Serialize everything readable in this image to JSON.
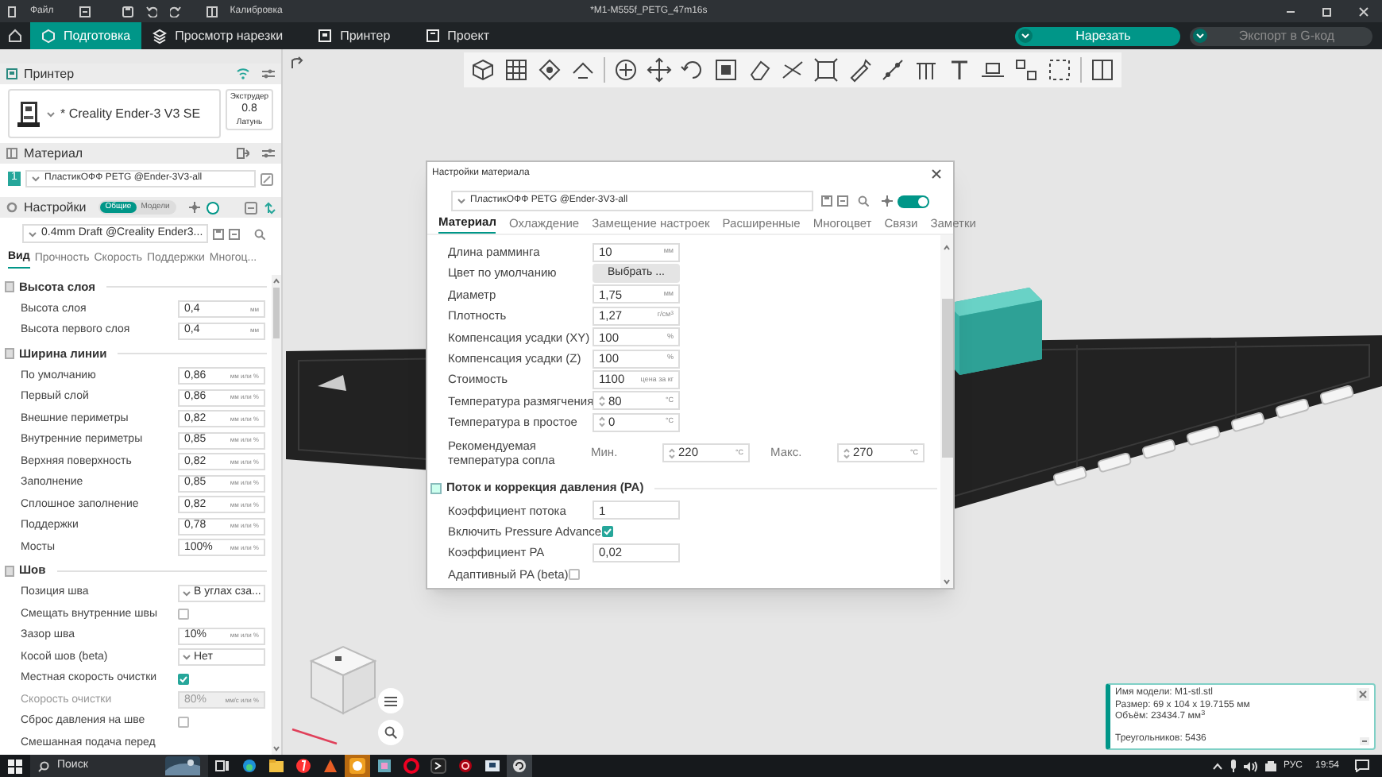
{
  "title_bar": {
    "menu": "Файл",
    "calibration": "Калибровка",
    "title": "*M1-M555f_PETG_47m16s"
  },
  "main_tabs": [
    {
      "label": "Подготовка",
      "selected": true
    },
    {
      "label": "Просмотр нарезки",
      "selected": false
    },
    {
      "label": "Принтер",
      "selected": false
    },
    {
      "label": "Проект",
      "selected": false
    }
  ],
  "slice_button": {
    "label": "Нарезать",
    "disabled": false
  },
  "export_button": {
    "label": "Экспорт в G-код",
    "disabled": true
  },
  "printer": {
    "heading": "Принтер",
    "name": "* Creality Ender-3 V3 SE",
    "extruder_label": "Экструдер",
    "nozzle": "0.8",
    "nozzle_material": "Латунь"
  },
  "material": {
    "heading": "Материал",
    "slot": "1",
    "filament": "ПластикОФФ PETG @Ender-3V3-all"
  },
  "settings": {
    "heading": "Настройки",
    "scope": [
      {
        "label": "Общие",
        "selected": true
      },
      {
        "label": "Модели",
        "selected": false
      }
    ],
    "advanced_on": true,
    "preset": "0.4mm Draft @Creality Ender3...",
    "tabs": [
      {
        "label": "Вид",
        "selected": true
      },
      {
        "label": "Прочность",
        "selected": false
      },
      {
        "label": "Скорость",
        "selected": false
      },
      {
        "label": "Поддержки",
        "selected": false
      },
      {
        "label": "Многоц...",
        "selected": false
      }
    ],
    "groups": [
      {
        "title": "Высота слоя",
        "rows": [
          {
            "kind": "field",
            "label": "Высота слоя",
            "value": "0,4",
            "unit": "мм",
            "disabled": false
          },
          {
            "kind": "field",
            "label": "Высота первого слоя",
            "value": "0,4",
            "unit": "мм",
            "disabled": false
          }
        ]
      },
      {
        "title": "Ширина линии",
        "rows": [
          {
            "kind": "field",
            "label": "По умолчанию",
            "value": "0,86",
            "unit": "мм или %",
            "disabled": false
          },
          {
            "kind": "field",
            "label": "Первый слой",
            "value": "0,86",
            "unit": "мм или %",
            "disabled": false
          },
          {
            "kind": "field",
            "label": "Внешние периметры",
            "value": "0,82",
            "unit": "мм или %",
            "disabled": false
          },
          {
            "kind": "field",
            "label": "Внутренние периметры",
            "value": "0,85",
            "unit": "мм или %",
            "disabled": false
          },
          {
            "kind": "field",
            "label": "Верхняя поверхность",
            "value": "0,82",
            "unit": "мм или %",
            "disabled": false
          },
          {
            "kind": "field",
            "label": "Заполнение",
            "value": "0,85",
            "unit": "мм или %",
            "disabled": false
          },
          {
            "kind": "field",
            "label": "Сплошное заполнение",
            "value": "0,82",
            "unit": "мм или %",
            "disabled": false
          },
          {
            "kind": "field",
            "label": "Поддержки",
            "value": "0,78",
            "unit": "мм или %",
            "disabled": false
          },
          {
            "kind": "field",
            "label": "Мосты",
            "value": "100%",
            "unit": "мм или %",
            "disabled": false
          }
        ]
      },
      {
        "title": "Шов",
        "rows": [
          {
            "kind": "dropdown",
            "label": "Позиция шва",
            "value": "В углах сза...",
            "disabled": false
          },
          {
            "kind": "checkbox",
            "label": "Смещать внутренние швы",
            "checked": false,
            "disabled": false
          },
          {
            "kind": "field",
            "label": "Зазор шва",
            "value": "10%",
            "unit": "мм или %",
            "disabled": false
          },
          {
            "kind": "dropdown",
            "label": "Косой шов (beta)",
            "value": "Нет",
            "disabled": false
          },
          {
            "kind": "checkbox",
            "label": "Местная скорость очистки",
            "checked": true,
            "disabled": false
          },
          {
            "kind": "field",
            "label": "Скорость очистки",
            "value": "80%",
            "unit": "мм/с или %",
            "disabled": true
          },
          {
            "kind": "checkbox",
            "label": "Сброс давления на шве",
            "checked": false,
            "disabled": false
          },
          {
            "kind": "text",
            "label": "Смешанная подача перед",
            "disabled": false
          }
        ]
      }
    ]
  },
  "material_dialog": {
    "title": "Настройки материала",
    "preset": "ПластикОФФ PETG @Ender-3V3-all",
    "advanced_on": true,
    "tabs": [
      {
        "label": "Материал",
        "selected": true
      },
      {
        "label": "Охлаждение",
        "selected": false
      },
      {
        "label": "Замещение настроек",
        "selected": false
      },
      {
        "label": "Расширенные",
        "selected": false
      },
      {
        "label": "Многоцвет",
        "selected": false
      },
      {
        "label": "Связи",
        "selected": false
      },
      {
        "label": "Заметки",
        "selected": false
      }
    ],
    "rows": [
      {
        "kind": "field",
        "label": "Длина рамминга",
        "value": "10",
        "unit": "мм"
      },
      {
        "kind": "button",
        "label": "Цвет по умолчанию",
        "value": "Выбрать ..."
      },
      {
        "kind": "field",
        "label": "Диаметр",
        "value": "1,75",
        "unit": "мм"
      },
      {
        "kind": "field",
        "label": "Плотность",
        "value": "1,27",
        "unit": "г/см$^{3}$"
      },
      {
        "kind": "field",
        "label": "Компенсация усадки (XY)",
        "value": "100",
        "unit": "%"
      },
      {
        "kind": "field",
        "label": "Компенсация усадки (Z)",
        "value": "100",
        "unit": "%"
      },
      {
        "kind": "field",
        "label": "Стоимость",
        "value": "1100",
        "unit": "цена за кг"
      },
      {
        "kind": "spinner",
        "label": "Температура размягчения",
        "value": "80",
        "unit": "°C"
      },
      {
        "kind": "spinner",
        "label": "Температура в простое",
        "value": "0",
        "unit": "°C"
      },
      {
        "kind": "range",
        "label": "Рекомендуемая температура сопла",
        "min_label": "Мин.",
        "min": "220",
        "max_label": "Макс.",
        "max": "270",
        "unit": "°C",
        "max_unit": "°C"
      }
    ],
    "sections": [
      {
        "title": "Поток и коррекция давления (PA)",
        "rows": [
          {
            "kind": "field",
            "label": "Коэффициент потока",
            "value": "1"
          },
          {
            "kind": "checkbox",
            "label": "Включить Pressure Advance",
            "checked": true
          },
          {
            "kind": "field",
            "label": "Коэффициент PA",
            "value": "0,02"
          },
          {
            "kind": "checkbox",
            "label": "Адаптивный PA (beta)",
            "checked": false
          }
        ]
      }
    ]
  },
  "notification": {
    "lines": [
      "Имя модели: M1-stl.stl",
      "Размер: 69 x 104 x 19.7155 мм",
      "Объём: 23434.7 мм$^{3}$"
    ],
    "triangles": "Треугольников: 5436"
  },
  "taskbar": {
    "search": "Поиск",
    "language": "РУС",
    "time": "19:54"
  }
}
